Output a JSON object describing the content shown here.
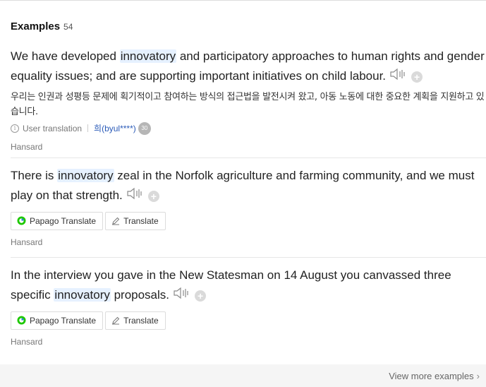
{
  "header": {
    "title": "Examples",
    "count": "54"
  },
  "examples": [
    {
      "en_before": "We have developed ",
      "en_highlight": "innovatory",
      "en_after": " and participatory approaches to human rights and gender equality issues; and are supporting important initiatives on child labour.",
      "ko": "우리는 인권과 성평등 문제에 획기적이고 참여하는 방식의 접근법을 발전시켜 왔고, 아동 노동에 대한 중요한 계획을 지원하고 있습니다.",
      "user_translation_label": "User translation",
      "user_name": "희(byul****)",
      "user_level": "30",
      "source": "Hansard"
    },
    {
      "en_before": "There is ",
      "en_highlight": "innovatory",
      "en_after": " zeal in the Norfolk agriculture and farming community, and we must play on that strength.",
      "papago_label": "Papago Translate",
      "translate_label": "Translate",
      "source": "Hansard"
    },
    {
      "en_before": "In the interview you gave in the New Statesman on 14 August you canvassed three specific ",
      "en_highlight": "innovatory",
      "en_after": " proposals.",
      "papago_label": "Papago Translate",
      "translate_label": "Translate",
      "source": "Hansard"
    }
  ],
  "footer": {
    "view_more": "View more examples"
  },
  "icons": {
    "speaker": "speaker-icon",
    "add": "add-icon",
    "info": "info-icon",
    "papago": "papago-logo-icon",
    "pencil": "pencil-icon",
    "chevron": "chevron-right-icon"
  },
  "colors": {
    "highlight": "#e6f1ff",
    "link": "#2b5bb8"
  }
}
